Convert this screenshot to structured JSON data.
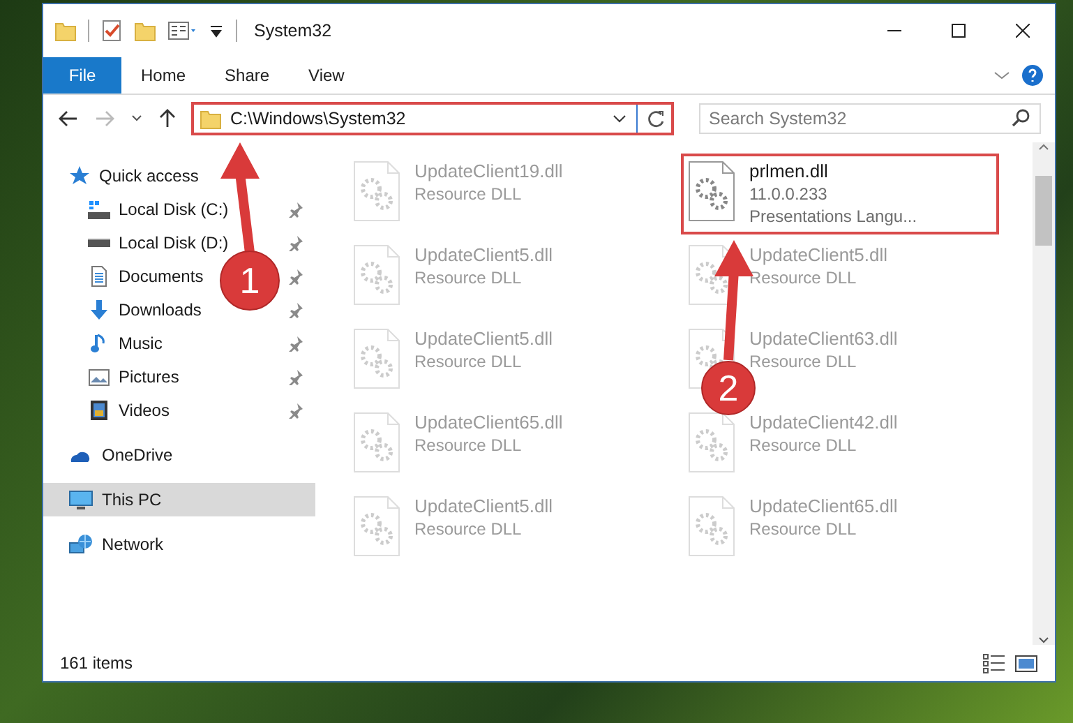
{
  "window": {
    "title": "System32"
  },
  "ribbon": {
    "tabs": [
      {
        "label": "File",
        "selected": true
      },
      {
        "label": "Home",
        "selected": false
      },
      {
        "label": "Share",
        "selected": false
      },
      {
        "label": "View",
        "selected": false
      }
    ]
  },
  "address_bar": {
    "path": "C:\\Windows\\System32",
    "outlined": true
  },
  "search": {
    "placeholder": "Search System32"
  },
  "sidebar": {
    "items": [
      {
        "label": "Quick access",
        "kind": "star",
        "selected": false,
        "children": [
          {
            "label": "Local Disk (C:)",
            "kind": "drive-c",
            "pinned": true
          },
          {
            "label": "Local Disk (D:)",
            "kind": "drive",
            "pinned": true
          },
          {
            "label": "Documents",
            "kind": "documents",
            "pinned": true
          },
          {
            "label": "Downloads",
            "kind": "downloads",
            "pinned": true
          },
          {
            "label": "Music",
            "kind": "music",
            "pinned": true
          },
          {
            "label": "Pictures",
            "kind": "pictures",
            "pinned": true
          },
          {
            "label": "Videos",
            "kind": "videos",
            "pinned": true
          }
        ]
      },
      {
        "label": "OneDrive",
        "kind": "cloud",
        "selected": false
      },
      {
        "label": "This PC",
        "kind": "pc",
        "selected": true
      },
      {
        "label": "Network",
        "kind": "network",
        "selected": false
      }
    ]
  },
  "files": [
    {
      "name": "UpdateClient19.dll",
      "description": "Resource DLL",
      "blurred": true,
      "outlined": false
    },
    {
      "name": "prlmen.dll",
      "version": "11.0.0.233",
      "description": "Presentations Langu...",
      "blurred": false,
      "outlined": true
    },
    {
      "name": "UpdateClient5.dll",
      "description": "Resource DLL",
      "blurred": true,
      "outlined": false
    },
    {
      "name": "UpdateClient5.dll",
      "description": "Resource DLL",
      "blurred": true,
      "outlined": false
    },
    {
      "name": "UpdateClient5.dll",
      "description": "Resource DLL",
      "blurred": true,
      "outlined": false
    },
    {
      "name": "UpdateClient63.dll",
      "description": "Resource DLL",
      "blurred": true,
      "outlined": false
    },
    {
      "name": "UpdateClient65.dll",
      "description": "Resource DLL",
      "blurred": true,
      "outlined": false
    },
    {
      "name": "UpdateClient42.dll",
      "description": "Resource DLL",
      "blurred": true,
      "outlined": false
    },
    {
      "name": "UpdateClient5.dll",
      "description": "Resource DLL",
      "blurred": true,
      "outlined": false
    },
    {
      "name": "UpdateClient65.dll",
      "description": "Resource DLL",
      "blurred": true,
      "outlined": false
    }
  ],
  "status_bar": {
    "item_count": "161 items"
  },
  "annotations": [
    {
      "label": "1"
    },
    {
      "label": "2"
    }
  ]
}
